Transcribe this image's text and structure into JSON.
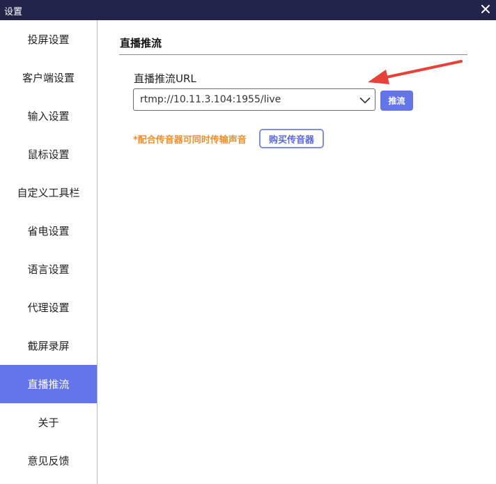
{
  "window": {
    "title": "设置",
    "close_icon": "close-icon"
  },
  "sidebar": {
    "items": [
      {
        "label": "投屏设置",
        "active": false
      },
      {
        "label": "客户端设置",
        "active": false
      },
      {
        "label": "输入设置",
        "active": false
      },
      {
        "label": "鼠标设置",
        "active": false
      },
      {
        "label": "自定义工具栏",
        "active": false
      },
      {
        "label": "省电设置",
        "active": false
      },
      {
        "label": "语言设置",
        "active": false
      },
      {
        "label": "代理设置",
        "active": false
      },
      {
        "label": "截屏录屏",
        "active": false
      },
      {
        "label": "直播推流",
        "active": true
      },
      {
        "label": "关于",
        "active": false
      },
      {
        "label": "意见反馈",
        "active": false
      }
    ]
  },
  "main": {
    "section_title": "直播推流",
    "url_label": "直播推流URL",
    "url_value": "rtmp://10.11.3.104:1955/live",
    "push_button": "推流",
    "note": "*配合传音器可同时传输声音",
    "buy_button": "购买传音器"
  },
  "colors": {
    "titlebar": "#23244a",
    "accent": "#6475ea",
    "note": "#ef8e2c",
    "annotation_arrow": "#e8413a"
  }
}
